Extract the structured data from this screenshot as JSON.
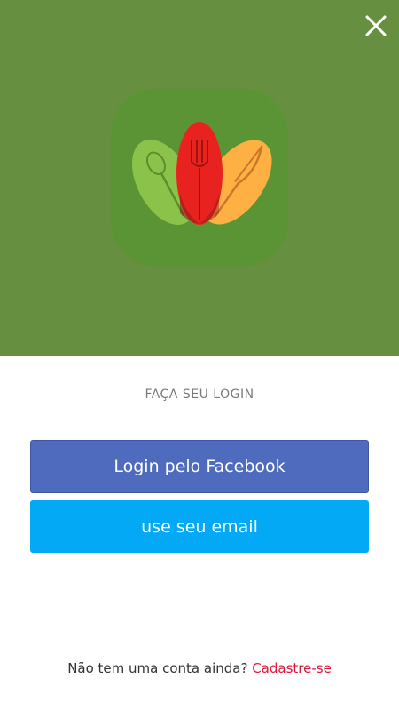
{
  "colors": {
    "hero_background": "#669040",
    "icon_background": "#5b9434",
    "facebook_button": "#4f6bbd",
    "email_button": "#03a9f4",
    "signup_link": "#e0163a"
  },
  "header": {
    "close_icon": "close-icon",
    "logo_icon": "utensils-leaf-icon"
  },
  "login": {
    "title": "FAÇA SEU LOGIN",
    "facebook_label": "Login pelo Facebook",
    "email_label": "use seu email"
  },
  "signup": {
    "prompt": "Não tem uma conta ainda? ",
    "link": "Cadastre-se"
  }
}
